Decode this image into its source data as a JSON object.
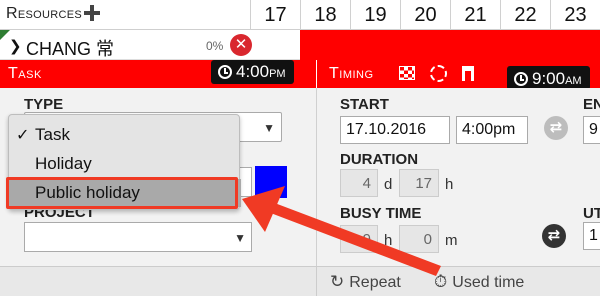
{
  "calendar": {
    "resources_label": "Resources",
    "days": [
      "17",
      "18",
      "19",
      "20",
      "21",
      "22",
      "23"
    ]
  },
  "resource_row": {
    "name": "CHANG 常",
    "percent": "0%",
    "remove_glyph": "✕"
  },
  "task_panel": {
    "title": "Task",
    "start_badge_time": "4:00",
    "start_badge_ampm": "PM",
    "type_label": "TYPE",
    "project_label": "PROJECT",
    "color_hex": "#0000ff"
  },
  "type_dropdown": {
    "selected_index": 0,
    "check_glyph": "✓",
    "options": [
      "Task",
      "Holiday",
      "Public holiday"
    ],
    "highlighted_index": 2
  },
  "timing_panel": {
    "title": "Timing",
    "end_badge_time": "9:00",
    "end_badge_ampm": "AM",
    "start_label": "START",
    "start_date": "17.10.2016",
    "start_time": "4:00pm",
    "end_label_partial": "EN",
    "end_value_partial": "9",
    "duration_label": "DURATION",
    "duration_days": "4",
    "duration_days_unit": "d",
    "duration_hours": "17",
    "duration_hours_unit": "h",
    "busy_label": "BUSY TIME",
    "busy_hours": "9",
    "busy_hours_unit": "h",
    "busy_minutes": "0",
    "busy_minutes_unit": "m",
    "ut_label_partial": "UT",
    "ut_value_partial": "1"
  },
  "bottom_bar": {
    "repeat_label": "Repeat",
    "used_time_label": "Used time"
  },
  "colors": {
    "accent_red": "#ff0000",
    "annotation": "#f03a24",
    "badge": "#111111"
  }
}
